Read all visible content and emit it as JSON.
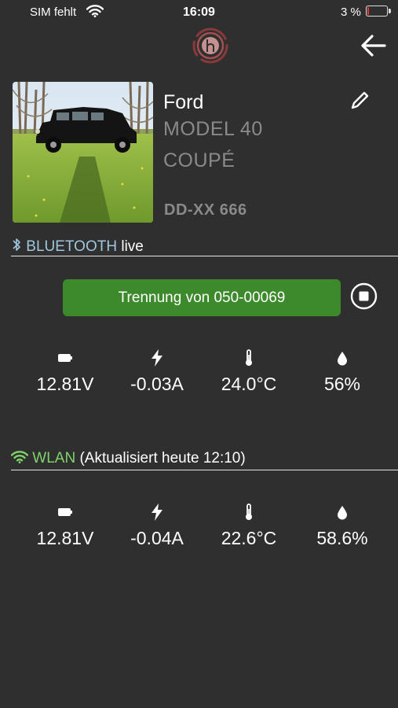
{
  "status_bar": {
    "carrier": "SIM fehlt",
    "time": "16:09",
    "battery_percent_text": "3 %",
    "battery_level": 0.03,
    "battery_color": "#e53935"
  },
  "header": {
    "logo_icon": "brand-logo-icon",
    "back_icon": "arrow-left-icon"
  },
  "vehicle": {
    "make": "Ford",
    "model": "MODEL 40",
    "body": "COUPÉ",
    "plate": "DD-XX 666",
    "edit_icon": "pencil-icon"
  },
  "bluetooth": {
    "label": "BLUETOOTH",
    "state": "live",
    "accent": "#9ec6dc",
    "disconnect_label": "Trennung von 050-00069",
    "button_color": "#3d8a2c",
    "metrics": {
      "voltage": "12.81V",
      "current": "-0.03A",
      "temperature": "24.0°C",
      "humidity": "56%"
    }
  },
  "wlan": {
    "label": "WLAN",
    "updated": "(Aktualisiert heute 12:10)",
    "accent": "#7ed36a",
    "metrics": {
      "voltage": "12.81V",
      "current": "-0.04A",
      "temperature": "22.6°C",
      "humidity": "58.6%"
    }
  }
}
